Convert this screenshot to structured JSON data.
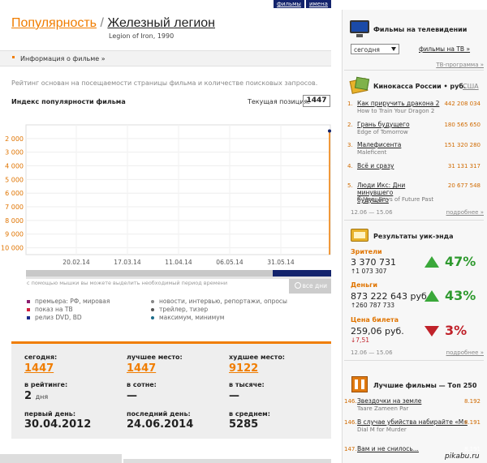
{
  "top_tabs": [
    "фильмы",
    "имена"
  ],
  "title": {
    "popularity": "Популярность",
    "sep": "/",
    "film": "Железный легион",
    "subtitle": "Legion of Iron, 1990"
  },
  "info_link": "Информация о фильме »",
  "description": "Рейтинг основан на посещаемости страницы фильма и количестве поисковых запросов.",
  "chart_header": {
    "title": "Индекс популярности фильма",
    "current_label": "Текущая позиция:",
    "current_value": "1447"
  },
  "chart_data": {
    "type": "line",
    "title": "Индекс популярности фильма",
    "y_tick_labels": [
      "2 000",
      "3 000",
      "4 000",
      "5 000",
      "6 000",
      "7 000",
      "8 000",
      "9 000",
      "10 000"
    ],
    "x_tick_labels": [
      "20.02.14",
      "17.03.14",
      "11.04.14",
      "06.05.14",
      "31.05.14"
    ],
    "y_inverted": true,
    "series": [
      {
        "points": [
          {
            "x": "24.06.14",
            "y": 1447
          }
        ]
      }
    ],
    "grid": true
  },
  "slider_hint": "с помощью мышки вы можете выделить необходимый период времени",
  "all_days_button": "все дни",
  "legend": [
    {
      "label": "премьера: РФ, мировая",
      "color": "#8b1e6f"
    },
    {
      "label": "показ на ТВ",
      "color": "#d11f3f"
    },
    {
      "label": "релиз DVD, BD",
      "color": "#1b2a8a"
    },
    {
      "label": "новости, интервью, репортажи, опросы",
      "color": "#888888"
    },
    {
      "label": "трейлер, тизер",
      "color": "#555555"
    },
    {
      "label": "максимум, минимум",
      "color": "#1b6c8a"
    }
  ],
  "stats": {
    "today_label": "сегодня:",
    "today": "1447",
    "best_label": "лучшее место:",
    "best": "1447",
    "worst_label": "худшее место:",
    "worst": "9122",
    "rating_label": "в рейтинге:",
    "rating_num": "2",
    "rating_unit": "дня",
    "hundred_label": "в сотне:",
    "hundred": "—",
    "thousand_label": "в тысяче:",
    "thousand": "—",
    "first_label": "первый день:",
    "first": "30.04.2012",
    "last_label": "последний день:",
    "last": "24.06.2014",
    "avg_label": "в среднем:",
    "avg": "5285"
  },
  "sidebar": {
    "tv": {
      "title": "Фильмы на телевидении",
      "select": "сегодня",
      "link": "фильмы на ТВ »",
      "more": "ТВ-программа »"
    },
    "box": {
      "title": "Кинокасса России",
      "unit": "• руб.",
      "usa": "США",
      "items": [
        {
          "rank": "1.",
          "name": "Как приручить дракона 2",
          "orig": "How to Train Your Dragon 2",
          "value": "442 208 034"
        },
        {
          "rank": "2.",
          "name": "Грань будущего",
          "orig": "Edge of Tomorrow",
          "value": "180 565 650"
        },
        {
          "rank": "3.",
          "name": "Малефисента",
          "orig": "Maleficent",
          "value": "151 320 280"
        },
        {
          "rank": "4.",
          "name": "Всё и сразу",
          "orig": "",
          "value": "31 131 317"
        },
        {
          "rank": "5.",
          "name": "Люди Икс: Дни минувшего будущего",
          "orig": "X-Men: Days of Future Past",
          "value": "20 677 548"
        }
      ],
      "dates": "12.06 — 15.06",
      "more": "подробнее »"
    },
    "weekend": {
      "title": "Результаты уик-энда",
      "viewers_label": "Зрители",
      "viewers": "3 370 731",
      "viewers_delta": "↑1 073 307",
      "viewers_pct": "47%",
      "money_label": "Деньги",
      "money": "873 222 643 руб.",
      "money_delta": "↑260 787 733",
      "money_pct": "43%",
      "price_label": "Цена билета",
      "price": "259,06 руб.",
      "price_delta": "↓7,51",
      "price_pct": "3%",
      "dates": "12.06 — 15.06",
      "more": "подробнее »"
    },
    "top250": {
      "title": "Лучшие фильмы — Топ 250",
      "items": [
        {
          "rank": "146.",
          "name": "Звездочки на земле",
          "orig": "Taare Zameen Par",
          "value": "8.192"
        },
        {
          "rank": "146.",
          "name": "В случае убийства набирайте «М»",
          "orig": "Dial M for Murder",
          "value": "8.191"
        },
        {
          "rank": "147.",
          "name": "Вам и не снилось...",
          "orig": "",
          "value": "8.191"
        }
      ]
    }
  },
  "watermark": "pikabu.ru"
}
